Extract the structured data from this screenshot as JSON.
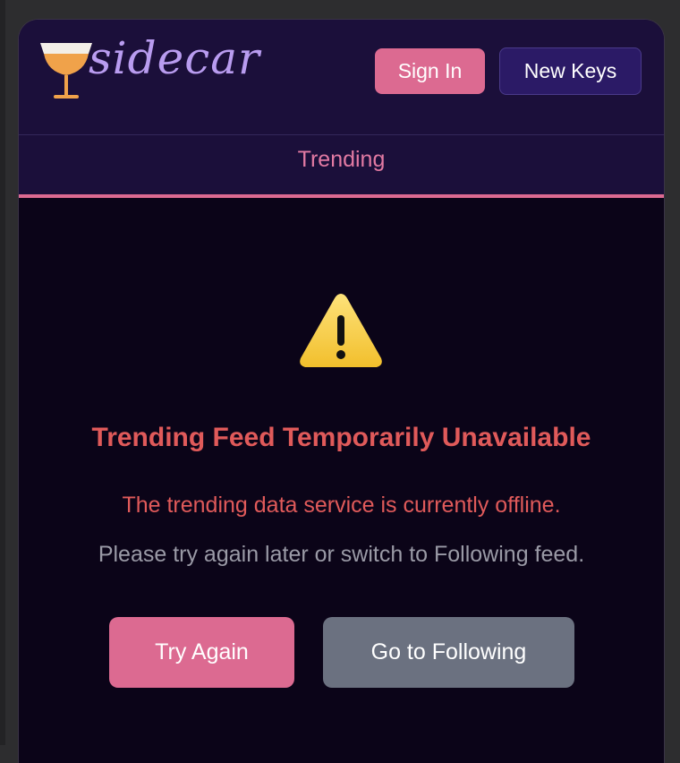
{
  "header": {
    "logo_text": "sidecar",
    "sign_in_label": "Sign In",
    "new_keys_label": "New Keys"
  },
  "tabs": [
    {
      "label": "Trending",
      "active": true
    }
  ],
  "error": {
    "icon": "warning-icon",
    "title": "Trending Feed Temporarily Unavailable",
    "message": "The trending data service is currently offline.",
    "hint": "Please try again later or switch to Following feed."
  },
  "actions": {
    "retry_label": "Try Again",
    "following_label": "Go to Following"
  },
  "colors": {
    "background": "#0b0418",
    "header": "#1b0f3a",
    "accent_pink": "#dc6a91",
    "logo_purple": "#b99cf0",
    "error_red": "#e05a5a",
    "muted_text": "#9a9aa6",
    "secondary_button": "#6b7180"
  }
}
